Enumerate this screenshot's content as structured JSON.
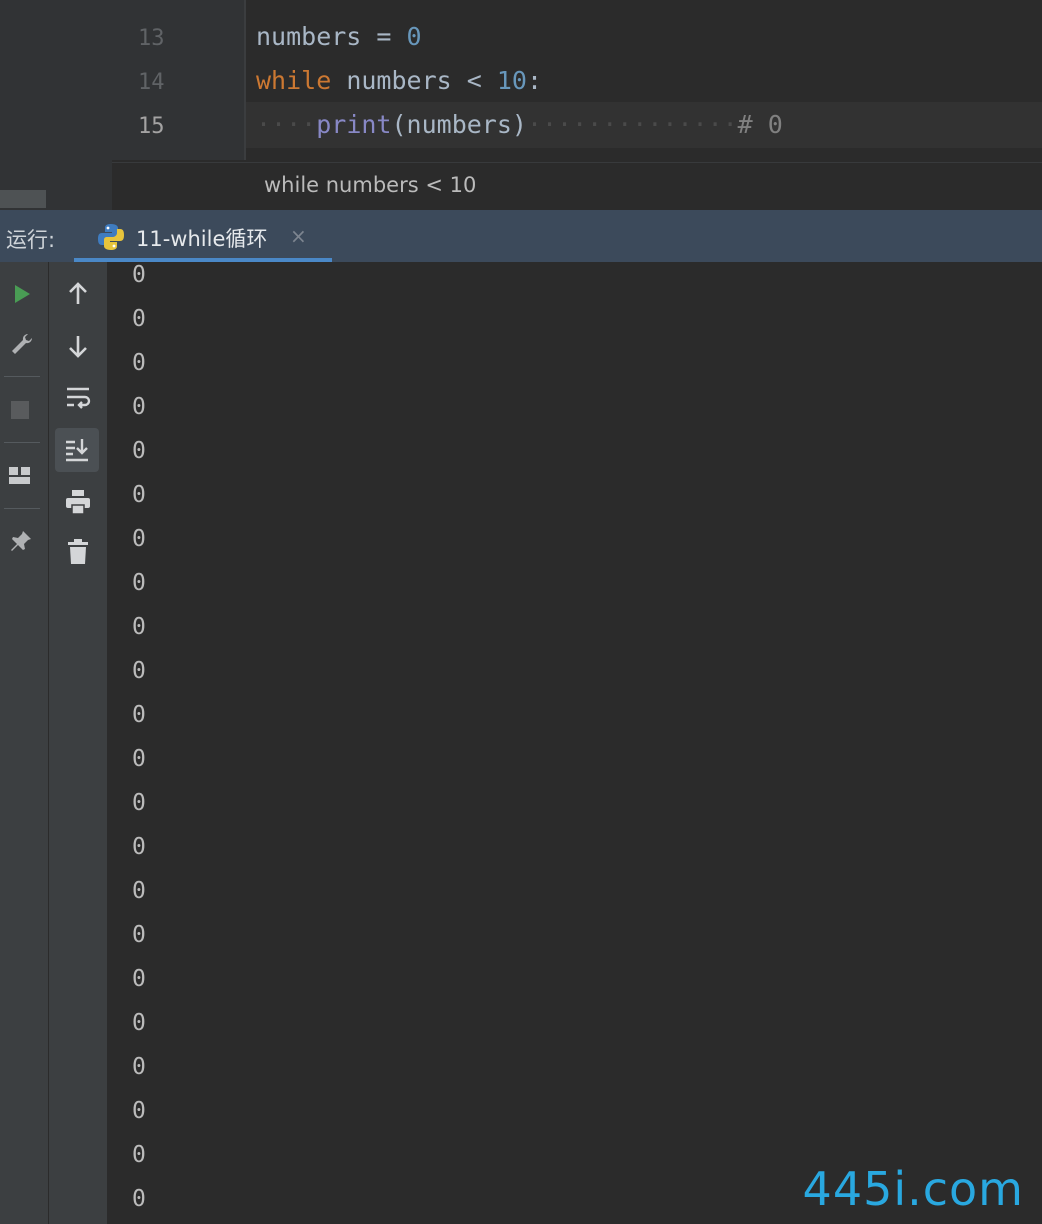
{
  "editor": {
    "line_numbers": [
      "13",
      "14",
      "15"
    ],
    "code": {
      "line13": {
        "var": "numbers",
        "op": " = ",
        "val": "0"
      },
      "line14": {
        "kw": "while",
        "var": " numbers ",
        "op": "< ",
        "val": "10",
        "tail": ":"
      },
      "line15": {
        "indent": "····",
        "fn": "print",
        "args": "(numbers)",
        "dots": "··············",
        "comment": "# 0"
      }
    },
    "breadcrumb": "while numbers < 10"
  },
  "run_panel": {
    "label": "运行:",
    "tab_label": "11-while循环",
    "tab_close": "×"
  },
  "toolbar_left": [
    {
      "icon": "run-icon"
    },
    {
      "icon": "wrench-icon"
    },
    {
      "icon": "stop-icon"
    },
    {
      "icon": "layout-icon"
    },
    {
      "icon": "pin-icon"
    }
  ],
  "toolbar_inner": [
    {
      "icon": "arrow-up-icon"
    },
    {
      "icon": "arrow-down-icon"
    },
    {
      "icon": "soft-wrap-icon"
    },
    {
      "icon": "scroll-to-end-icon"
    },
    {
      "icon": "print-icon"
    },
    {
      "icon": "trash-icon"
    }
  ],
  "console_output": [
    "0",
    "0",
    "0",
    "0",
    "0",
    "0",
    "0",
    "0",
    "0",
    "0",
    "0",
    "0",
    "0",
    "0",
    "0",
    "0",
    "0",
    "0",
    "0",
    "0",
    "0",
    "0"
  ],
  "watermark": "445i.com",
  "colors": {
    "accent": "#4a88c7",
    "run_green": "#499c54",
    "watermark": "#29a8e0"
  }
}
